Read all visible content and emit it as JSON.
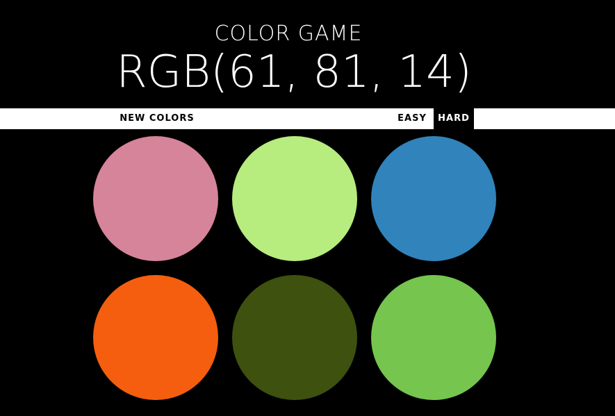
{
  "header": {
    "title": "COLOR GAME",
    "target_color": "RGB(61, 81, 14)"
  },
  "controls": {
    "new_colors_label": "NEW COLORS",
    "message": "",
    "easy_label": "EASY",
    "hard_label": "HARD",
    "selected_mode": "hard"
  },
  "squares": [
    {
      "color": "#d6849a"
    },
    {
      "color": "#b7ec7f"
    },
    {
      "color": "#3183bb"
    },
    {
      "color": "#f45e0e"
    },
    {
      "color": "#3e510e"
    },
    {
      "color": "#76c54e"
    }
  ]
}
